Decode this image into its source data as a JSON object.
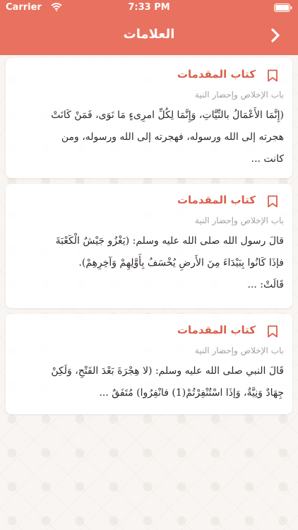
{
  "status": {
    "carrier": "Carrier",
    "time": "7:33 PM"
  },
  "nav": {
    "title": "العلامات",
    "back_icon": "chevron-right-icon"
  },
  "bookmarks": [
    {
      "book": "كتاب المقدمات",
      "chapter": "باب الإخلاص وإحضار النية",
      "lines": [
        "(إِنَّمَا الأَعْمَالُ بالنِّيَّاتِ، وَإِنَّمَا لِكُلِّ امرِىءٍ مَا نَوَى، فَمَنْ كَانَتْ",
        "هجرته إلى الله ورسوله، فهجرته إلى الله ورسوله، ومن",
        "كانت ..."
      ]
    },
    {
      "book": "كتاب المقدمات",
      "chapter": "باب الإخلاص وإحضار النية",
      "lines": [
        "قالَ رسول الله صلى الله عليه وسلم: (يَغْزُو جَيْشٌ الْكَعْبَةَ",
        "فإذَا كَانُوا بِبَيْدَاءَ مِنَ الأَرضِ يُخْسَفُ بِأَوَّلِهِمْ وَآخِرِهِمْ).",
        "قَالَتْ: ..."
      ]
    },
    {
      "book": "كتاب المقدمات",
      "chapter": "باب الإخلاص وإحضار النية",
      "lines": [
        "قَالَ النبي صلى الله عليه وسلم: (لا هِجْرَةَ بَعْدَ الفَتْحِ، وَلَكِنْ",
        "جِهَادٌ وَنِيَّةٌ، وَإذَا اسْتُنْفِرْتُمْ(1) فانْفِرُوا) مُتَفَقٌ ..."
      ]
    }
  ],
  "colors": {
    "header": "#e8725f",
    "accent": "#d9604d",
    "muted_text": "#a7a2a0",
    "body_text": "#2f2a28"
  }
}
